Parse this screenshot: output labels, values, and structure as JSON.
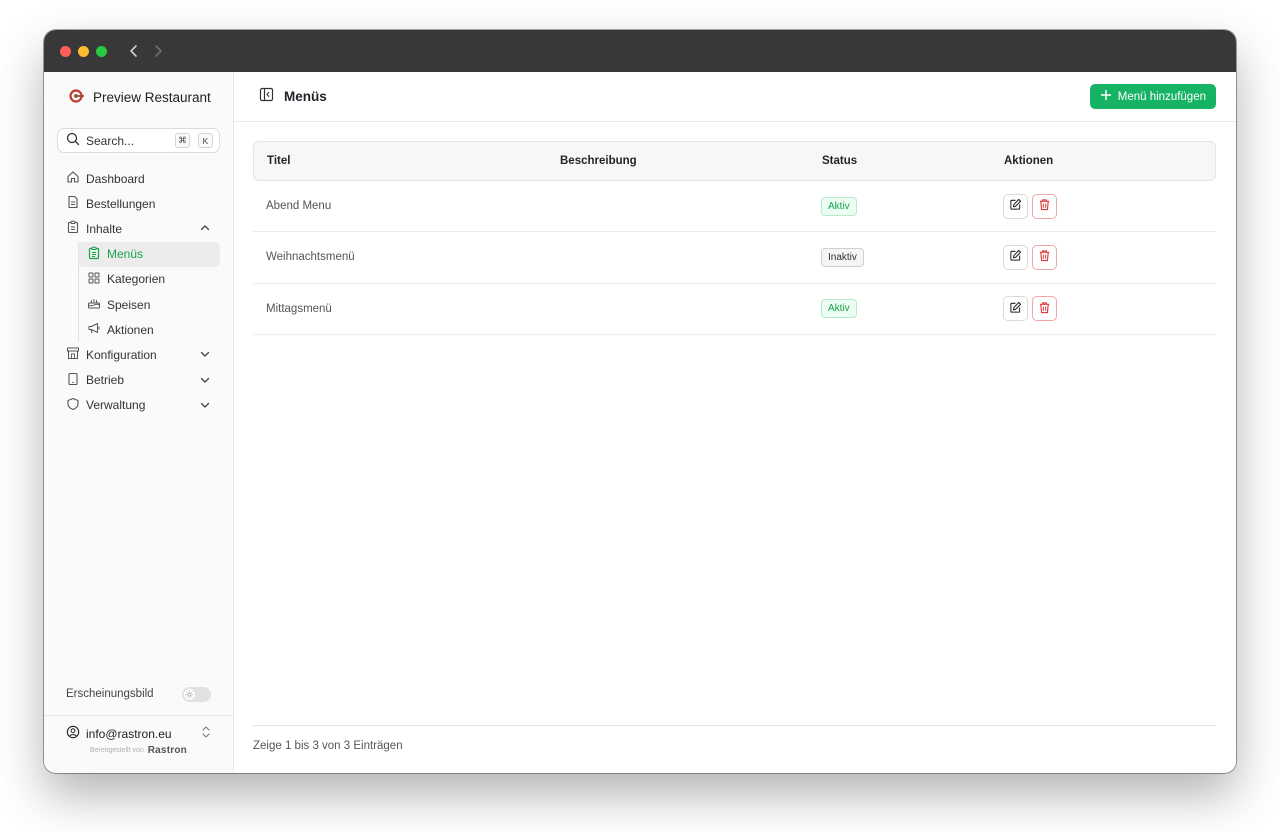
{
  "window": {
    "traffic_lights": [
      "#ff5f57",
      "#febc2e",
      "#28c840"
    ]
  },
  "brand": {
    "name": "Preview Restaurant",
    "logo_color": "#c0392b"
  },
  "search": {
    "label": "Search...",
    "shortcut_mod": "⌘",
    "shortcut_key": "K"
  },
  "sidebar": {
    "items": [
      {
        "label": "Dashboard",
        "icon": "home-icon"
      },
      {
        "label": "Bestellungen",
        "icon": "file-icon"
      },
      {
        "label": "Inhalte",
        "icon": "clipboard-icon",
        "expanded": true
      },
      {
        "label": "Konfiguration",
        "icon": "store-icon"
      },
      {
        "label": "Betrieb",
        "icon": "tablet-icon"
      },
      {
        "label": "Verwaltung",
        "icon": "shield-icon"
      }
    ],
    "sub_items": [
      {
        "label": "Menüs",
        "icon": "clipboard-list-icon",
        "active": true
      },
      {
        "label": "Kategorien",
        "icon": "grid-icon"
      },
      {
        "label": "Speisen",
        "icon": "cake-icon"
      },
      {
        "label": "Aktionen",
        "icon": "megaphone-icon"
      }
    ],
    "appearance_label": "Erscheinungsbild",
    "account_email": "info@rastron.eu",
    "powered_by": "Bereitgestellt von",
    "powered_logo": "Rastron"
  },
  "header": {
    "title": "Menüs",
    "add_button": "Menü hinzufügen",
    "accent": "#16b364"
  },
  "table": {
    "columns": [
      "Titel",
      "Beschreibung",
      "Status",
      "Aktionen"
    ],
    "rows": [
      {
        "title": "Abend Menu",
        "description": "",
        "status": "Aktiv",
        "status_type": "active"
      },
      {
        "title": "Weihnachtsmenü",
        "description": "",
        "status": "Inaktiv",
        "status_type": "inactive"
      },
      {
        "title": "Mittagsmenü",
        "description": "",
        "status": "Aktiv",
        "status_type": "active"
      }
    ],
    "footer": "Zeige 1 bis 3 von 3 Einträgen"
  }
}
